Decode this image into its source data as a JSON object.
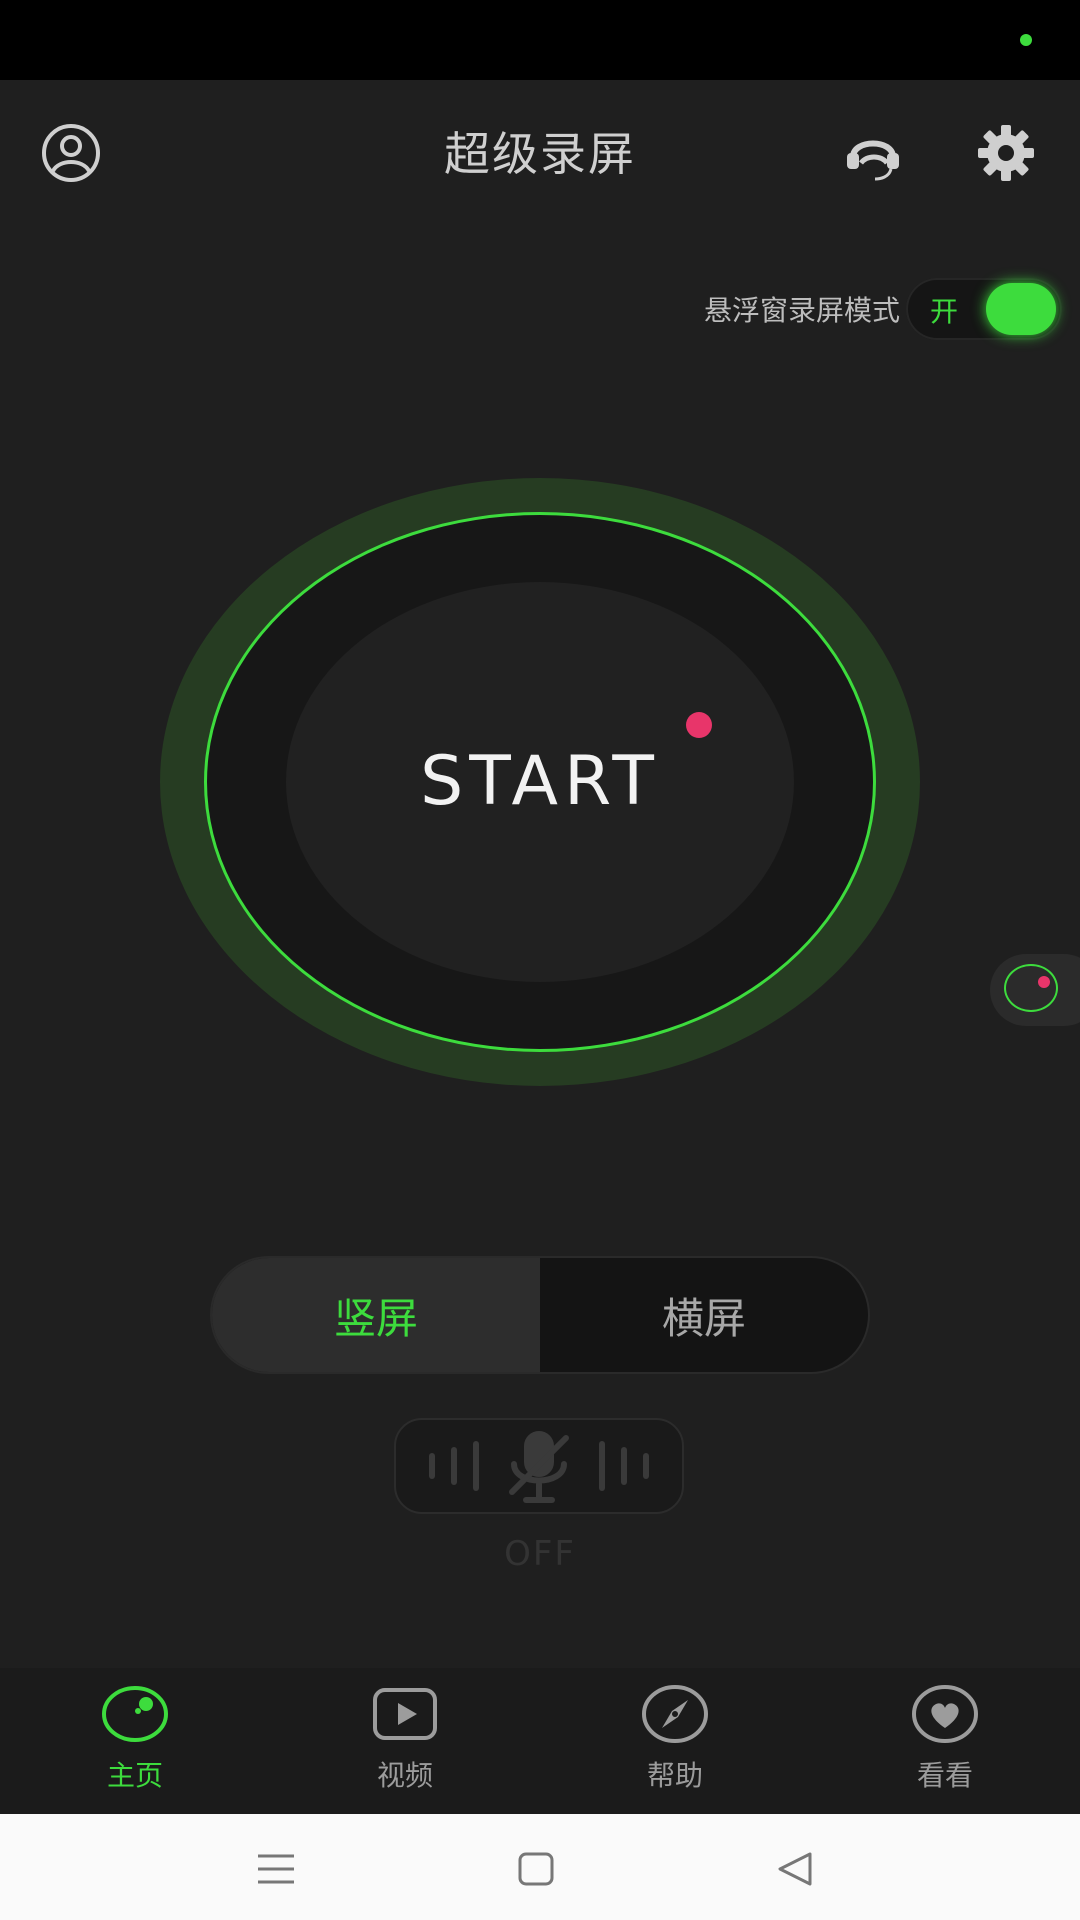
{
  "header": {
    "title": "超级录屏",
    "profile_icon": "user-circle-icon",
    "support_icon": "headset-icon",
    "settings_icon": "gear-icon"
  },
  "float_mode": {
    "label": "悬浮窗录屏模式",
    "toggle_text": "开",
    "enabled": true
  },
  "record": {
    "start_label": "START"
  },
  "orientation": {
    "portrait_label": "竖屏",
    "landscape_label": "横屏",
    "selected": "portrait"
  },
  "audio": {
    "mic_icon": "mic-muted-icon",
    "state_label": "OFF"
  },
  "bottom_nav": {
    "items": [
      {
        "label": "主页",
        "icon": "home-record-icon",
        "active": true
      },
      {
        "label": "视频",
        "icon": "video-play-icon",
        "active": false
      },
      {
        "label": "帮助",
        "icon": "compass-icon",
        "active": false
      },
      {
        "label": "看看",
        "icon": "heart-icon",
        "active": false
      }
    ]
  },
  "system_nav": {
    "menu_icon": "menu-icon",
    "home_icon": "home-square-icon",
    "back_icon": "back-triangle-icon"
  },
  "colors": {
    "accent": "#3ddc3d",
    "record_dot": "#e8356a",
    "background": "#1f1f1f"
  }
}
